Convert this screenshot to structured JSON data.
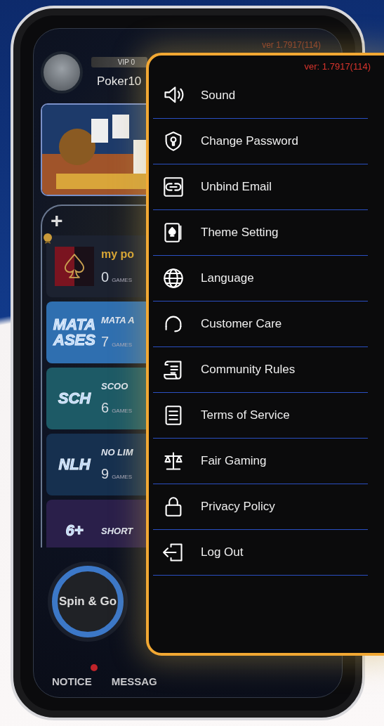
{
  "app": {
    "version": "ver 1.7917(114)",
    "vip": "VIP 0",
    "username": "Poker10",
    "add_button": "+",
    "clubs": [
      {
        "kind": "own",
        "name": "my po",
        "games": "0",
        "games_label": "GAMES",
        "color": "#1c2230"
      },
      {
        "kind": "logo",
        "logo": "MATA ASES",
        "name": "MATA A",
        "games": "7",
        "games_label": "GAMES",
        "color": "#2f6fb0"
      },
      {
        "kind": "logo",
        "logo": "SCH",
        "name": "SCOO",
        "games": "6",
        "games_label": "GAMES",
        "color": "#1d5a66"
      },
      {
        "kind": "logo",
        "logo": "NLH",
        "name": "NO LIM",
        "games": "9",
        "games_label": "GAMES",
        "color": "#16304f"
      },
      {
        "kind": "logo",
        "logo": "6+",
        "name": "SHORT",
        "color": "#2a1f4a"
      }
    ],
    "spin_button": "Spin & Go",
    "nav": [
      {
        "label": "NOTICE",
        "badge": true
      },
      {
        "label": "MESSAG",
        "badge": false
      }
    ]
  },
  "menu": {
    "version": "ver: 1.7917(114)",
    "items": [
      {
        "label": "Sound"
      },
      {
        "label": "Change Password"
      },
      {
        "label": "Unbind Email"
      },
      {
        "label": "Theme Setting"
      },
      {
        "label": "Language"
      },
      {
        "label": "Customer Care"
      },
      {
        "label": "Community Rules"
      },
      {
        "label": "Terms of Service"
      },
      {
        "label": "Fair Gaming"
      },
      {
        "label": "Privacy Policy"
      },
      {
        "label": "Log Out"
      }
    ]
  }
}
